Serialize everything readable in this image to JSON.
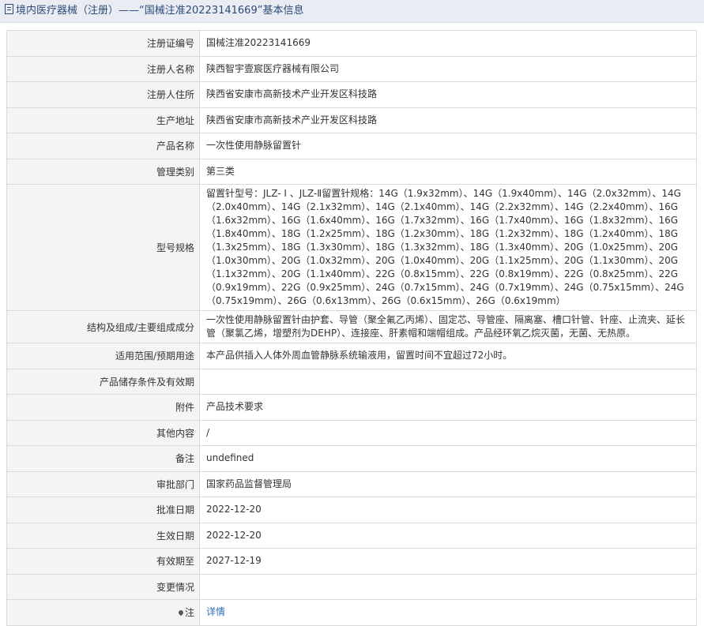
{
  "header": {
    "title": "境内医疗器械（注册）——“国械注准20223141669”基本信息"
  },
  "fields": [
    {
      "label": "注册证编号",
      "value": "国械注准20223141669"
    },
    {
      "label": "注册人名称",
      "value": "陕西智宇壹宸医疗器械有限公司"
    },
    {
      "label": "注册人住所",
      "value": "陕西省安康市高新技术产业开发区科技路"
    },
    {
      "label": "生产地址",
      "value": "陕西省安康市高新技术产业开发区科技路"
    },
    {
      "label": "产品名称",
      "value": "一次性使用静脉留置针"
    },
    {
      "label": "管理类别",
      "value": "第三类"
    },
    {
      "label": "型号规格",
      "value": "留置针型号：JLZ- I 、JLZ-Ⅱ留置针规格：14G（1.9x32mm）、14G（1.9x40mm）、14G（2.0x32mm）、14G（2.0x40mm）、14G（2.1x32mm）、14G（2.1x40mm）、14G（2.2x32mm）、14G（2.2x40mm）、16G（1.6x32mm）、16G（1.6x40mm）、16G（1.7x32mm）、16G（1.7x40mm）、16G（1.8x32mm）、16G（1.8x40mm）、18G（1.2x25mm）、18G（1.2x30mm）、18G（1.2x32mm）、18G（1.2x40mm）、18G（1.3x25mm）、18G（1.3x30mm）、18G（1.3x32mm）、18G（1.3x40mm）、20G（1.0x25mm）、20G（1.0x30mm）、20G（1.0x32mm）、20G（1.0x40mm）、20G（1.1x25mm）、20G（1.1x30mm）、20G（1.1x32mm）、20G（1.1x40mm）、22G（0.8x15mm）、22G（0.8x19mm）、22G（0.8x25mm）、22G（0.9x19mm）、22G（0.9x25mm）、24G（0.7x15mm）、24G（0.7x19mm）、24G（0.75x15mm）、24G（0.75x19mm）、26G（0.6x13mm）、26G（0.6x15mm）、26G（0.6x19mm）"
    },
    {
      "label": "结构及组成/主要组成成分",
      "value": "一次性使用静脉留置针由护套、导管（聚全氟乙丙烯）、固定芯、导管座、隔离塞、槽口针管、针座、止流夹、延长管（聚氯乙烯，增塑剂为DEHP）、连接座、肝素帽和端帽组成。产品经环氧乙烷灭菌，无菌、无热原。"
    },
    {
      "label": "适用范围/预期用途",
      "value": "本产品供插入人体外周血管静脉系统输液用，留置时间不宜超过72小时。"
    },
    {
      "label": "产品储存条件及有效期",
      "value": ""
    },
    {
      "label": "附件",
      "value": "产品技术要求"
    },
    {
      "label": "其他内容",
      "value": "/"
    },
    {
      "label": "备注",
      "value": "undefined"
    },
    {
      "label": "审批部门",
      "value": "国家药品监督管理局"
    },
    {
      "label": "批准日期",
      "value": "2022-12-20"
    },
    {
      "label": "生效日期",
      "value": "2022-12-20"
    },
    {
      "label": "有效期至",
      "value": "2027-12-19"
    },
    {
      "label": "变更情况",
      "value": ""
    },
    {
      "label": "注",
      "value": "详情"
    }
  ]
}
